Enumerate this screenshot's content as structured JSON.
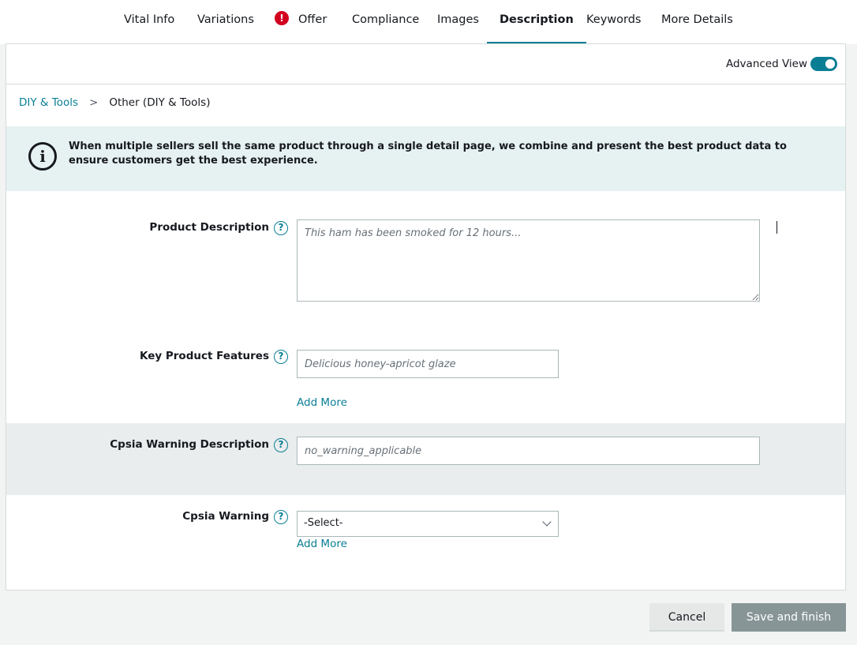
{
  "tabs": [
    {
      "label": "Vital Info"
    },
    {
      "label": "Variations"
    },
    {
      "label": "Offer",
      "error_icon": "!"
    },
    {
      "label": "Compliance"
    },
    {
      "label": "Images"
    },
    {
      "label": "Description",
      "active": true
    },
    {
      "label": "Keywords"
    },
    {
      "label": "More Details"
    }
  ],
  "advanced_view": {
    "label": "Advanced View",
    "enabled": true
  },
  "breadcrumb": {
    "parent": "DIY & Tools",
    "separator": ">",
    "current": "Other (DIY & Tools)"
  },
  "notice": {
    "icon": "info-icon",
    "icon_glyph": "i",
    "text": "When multiple sellers sell the same product through a single detail page, we combine and present the best product data to ensure customers get the best experience."
  },
  "fields": {
    "help_glyph": "?",
    "product_description": {
      "label": "Product Description",
      "placeholder": "This ham has been smoked for 12 hours..."
    },
    "key_product_features": {
      "label": "Key Product Features",
      "placeholder": "Delicious honey-apricot glaze",
      "add_more": "Add More"
    },
    "cpsia_warning_description": {
      "label": "Cpsia Warning Description",
      "placeholder": "no_warning_applicable"
    },
    "cpsia_warning": {
      "label": "Cpsia Warning",
      "value": "-Select-",
      "add_more": "Add More"
    }
  },
  "footer": {
    "cancel_label": "Cancel",
    "save_label": "Save and finish"
  },
  "colors": {
    "accent": "#0a7e95",
    "error": "#d1001f",
    "notice_bg": "#e6f1f1",
    "save_disabled": "#879596"
  }
}
